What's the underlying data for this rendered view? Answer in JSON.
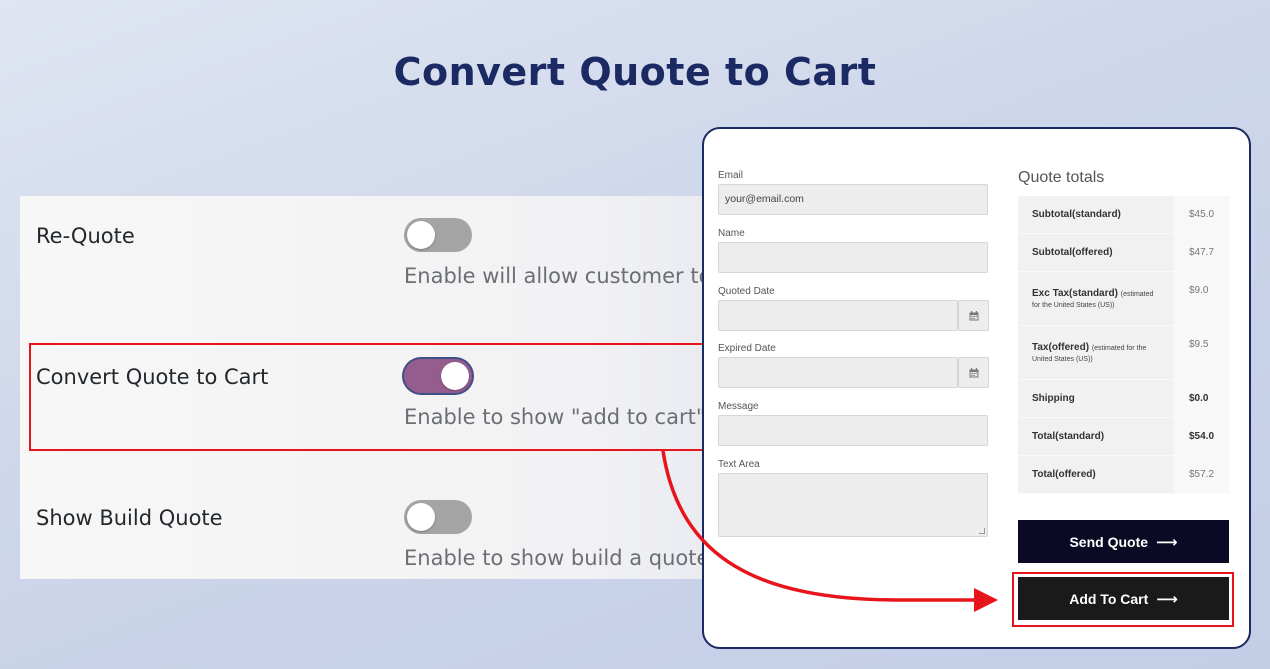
{
  "hero": {
    "title": "Convert Quote to Cart"
  },
  "settings": {
    "items": [
      {
        "label": "Re-Quote",
        "description": "Enable will allow customer to",
        "enabled": false
      },
      {
        "label": "Convert Quote to Cart",
        "description": "Enable to show \"add to cart\"",
        "enabled": true
      },
      {
        "label": "Show Build Quote",
        "description": "Enable to show build a quote",
        "enabled": false
      }
    ]
  },
  "form": {
    "email": {
      "label": "Email",
      "value": "your@email.com"
    },
    "name": {
      "label": "Name",
      "value": ""
    },
    "quoted_date": {
      "label": "Quoted Date",
      "value": ""
    },
    "expired_date": {
      "label": "Expired Date",
      "value": ""
    },
    "message": {
      "label": "Message",
      "value": ""
    },
    "text_area": {
      "label": "Text Area",
      "value": ""
    }
  },
  "quote_totals": {
    "title": "Quote totals",
    "rows": [
      {
        "label": "Subtotal(standard)",
        "note": "",
        "value": "$45.0"
      },
      {
        "label": "Subtotal(offered)",
        "note": "",
        "value": "$47.7"
      },
      {
        "label": "Exc Tax(standard)",
        "note": "(estimated for the United States (US))",
        "value": "$9.0"
      },
      {
        "label": "Tax(offered)",
        "note": "(estimated for the United States (US))",
        "value": "$9.5"
      },
      {
        "label": "Shipping",
        "note": "",
        "value": "$0.0"
      },
      {
        "label": "Total(standard)",
        "note": "",
        "value": "$54.0"
      },
      {
        "label": "Total(offered)",
        "note": "",
        "value": "$57.2"
      }
    ]
  },
  "buttons": {
    "send_quote": "Send Quote",
    "add_to_cart": "Add To Cart",
    "arrow": "⟶"
  },
  "colors": {
    "title": "#1b2a63",
    "toggle_on": "#955d8d",
    "highlight": "#e8141b",
    "send_button": "#0a0a24",
    "cart_button": "#1a1a1a"
  }
}
